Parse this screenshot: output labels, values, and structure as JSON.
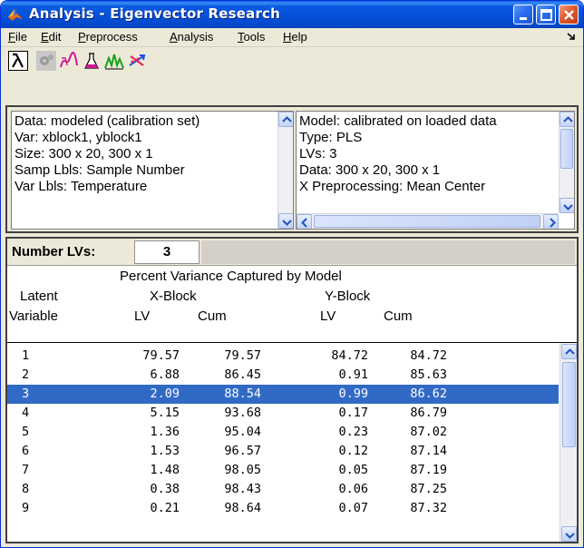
{
  "window": {
    "title": "Analysis - Eigenvector Research",
    "accent": "#0550d8"
  },
  "menu": {
    "items": [
      "File",
      "Edit",
      "Preprocess",
      "Analysis",
      "Tools",
      "Help"
    ],
    "underline": [
      "F",
      "E",
      "P",
      "A",
      "T",
      "H"
    ]
  },
  "toolbar": {
    "tools": [
      "lambda-icon",
      "gear-icon",
      "spectra-icon",
      "flask-icon",
      "peaks-icon",
      "scatter-arrows-icon"
    ]
  },
  "data_pane": {
    "lines": [
      "Data: modeled (calibration set)",
      "Var: xblock1, yblock1",
      "Size: 300 x 20, 300 x 1",
      "Samp Lbls: Sample Number",
      "Var Lbls: Temperature"
    ]
  },
  "model_pane": {
    "lines": [
      "Model: calibrated on loaded data",
      "Type: PLS",
      "LVs: 3",
      "Data: 300 x 20, 300 x 1",
      "X Preprocessing: Mean Center"
    ]
  },
  "lv_selector": {
    "label": "Number LVs:",
    "value": "3"
  },
  "variance_table": {
    "title": "Percent Variance Captured by Model",
    "col_latent": "Latent",
    "col_variable": "Variable",
    "xblock": "X-Block",
    "yblock": "Y-Block",
    "lv": "LV",
    "cum": "Cum",
    "selected_index": 2,
    "rows": [
      [
        "1",
        "79.57",
        "79.57",
        "84.72",
        "84.72"
      ],
      [
        "2",
        "6.88",
        "86.45",
        "0.91",
        "85.63"
      ],
      [
        "3",
        "2.09",
        "88.54",
        "0.99",
        "86.62"
      ],
      [
        "4",
        "5.15",
        "93.68",
        "0.17",
        "86.79"
      ],
      [
        "5",
        "1.36",
        "95.04",
        "0.23",
        "87.02"
      ],
      [
        "6",
        "1.53",
        "96.57",
        "0.12",
        "87.14"
      ],
      [
        "7",
        "1.48",
        "98.05",
        "0.05",
        "87.19"
      ],
      [
        "8",
        "0.38",
        "98.43",
        "0.06",
        "87.25"
      ],
      [
        "9",
        "0.21",
        "98.64",
        "0.07",
        "87.32"
      ]
    ]
  }
}
